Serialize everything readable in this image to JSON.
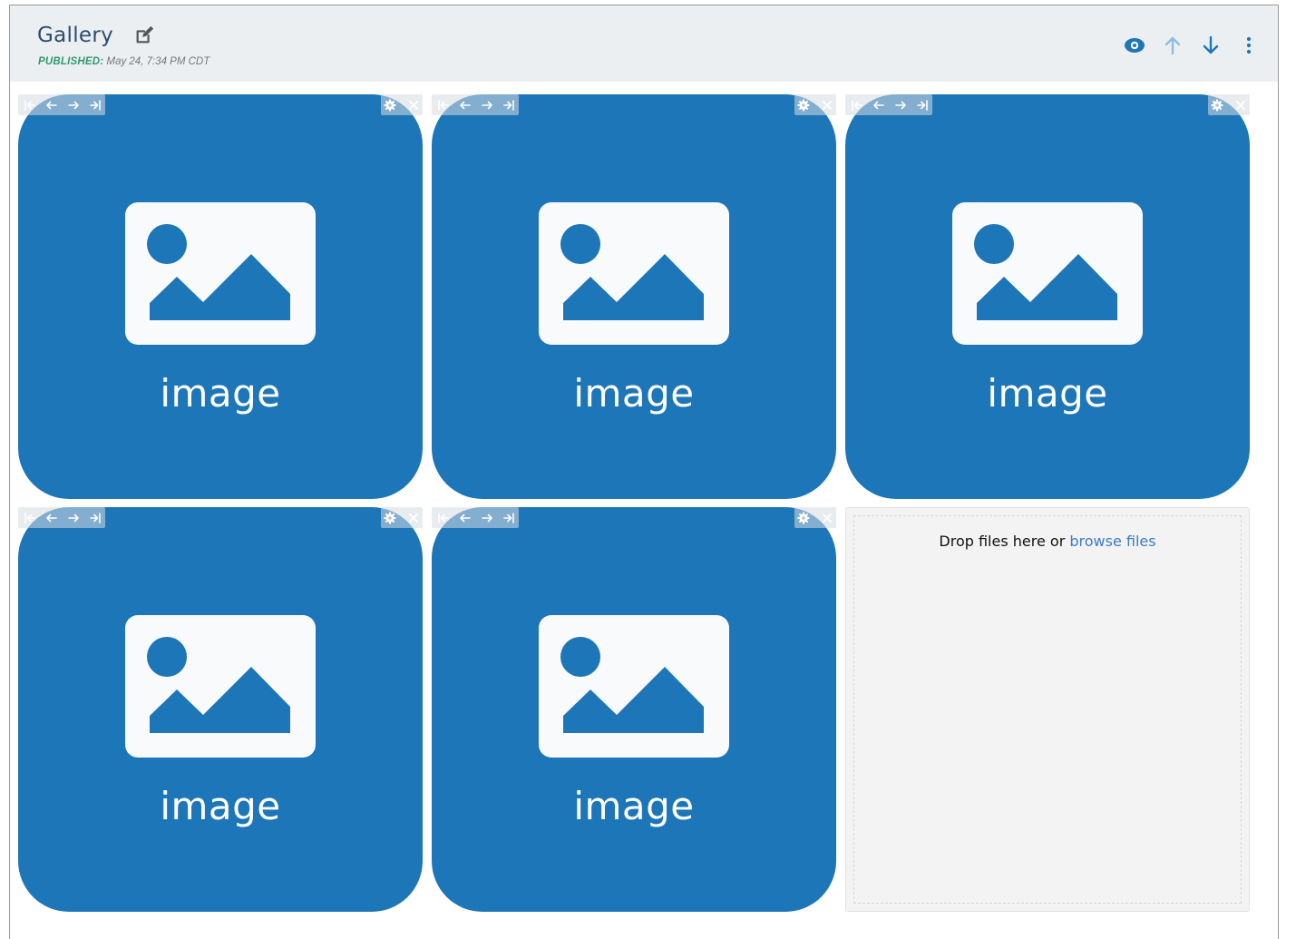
{
  "header": {
    "title": "Gallery",
    "status_label": "PUBLISHED:",
    "status_value": "May 24, 7:34 PM CDT",
    "actions": [
      "eye-icon",
      "arrow-up-icon",
      "arrow-down-icon",
      "more-vertical-icon"
    ]
  },
  "gallery": {
    "items": [
      {
        "label": "image"
      },
      {
        "label": "image"
      },
      {
        "label": "image"
      },
      {
        "label": "image"
      },
      {
        "label": "image"
      }
    ],
    "item_toolbar_icons": [
      "move-first-icon",
      "move-left-icon",
      "move-right-icon",
      "move-last-icon",
      "gear-icon",
      "close-icon"
    ]
  },
  "dropzone": {
    "text": "Drop files here or",
    "link": "browse files"
  },
  "colors": {
    "accent": "#1d76b8",
    "title": "#2a4d6e",
    "published": "#2f9a6e",
    "link": "#3a7bc8",
    "header_bg": "#eceff1"
  }
}
